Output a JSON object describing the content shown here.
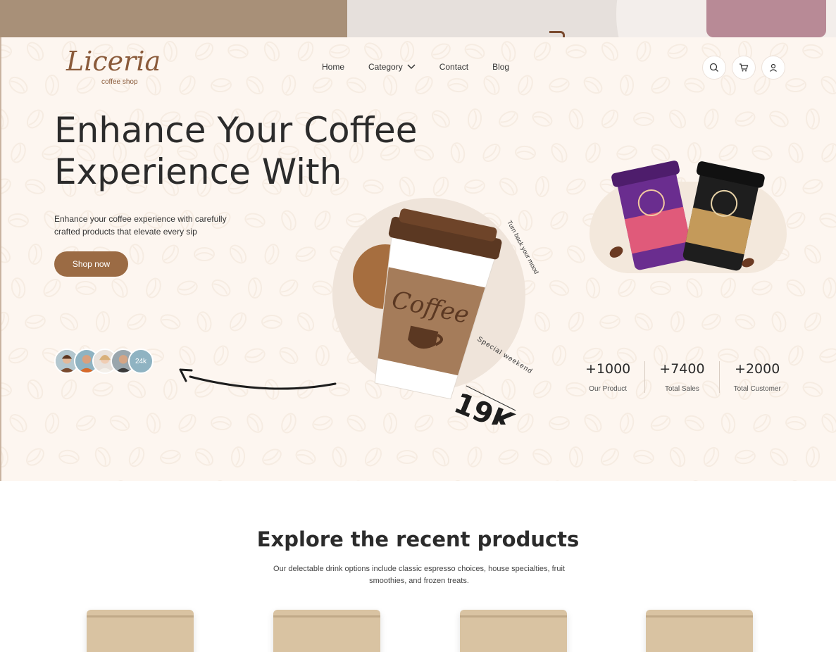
{
  "brand": {
    "logo_text": "Liceria",
    "logo_subtext": "coffee shop"
  },
  "nav": {
    "items": [
      {
        "label": "Home"
      },
      {
        "label": "Category"
      },
      {
        "label": "Contact"
      },
      {
        "label": "Blog"
      }
    ],
    "icons": [
      "search-icon",
      "cart-icon",
      "user-icon"
    ]
  },
  "hero": {
    "headline_line1": "Enhance Your Coffee",
    "headline_line2": "Experience With",
    "subtext": "Enhance your coffee experience with carefully crafted products that elevate every sip",
    "cta_label": "Shop now",
    "avatar_count_label": "24k",
    "cup_label": "Coffee",
    "curved_text": "Turn back your mood",
    "special_text": "Special weekend",
    "big_number": "19K"
  },
  "stats": [
    {
      "value": "+1000",
      "label": "Our Product"
    },
    {
      "value": "+7400",
      "label": "Total Sales"
    },
    {
      "value": "+2000",
      "label": "Total Customer"
    }
  ],
  "products": {
    "title": "Explore the recent products",
    "description": "Our delectable drink options include classic espresso choices, house specialties, fruit smoothies, and frozen treats.",
    "bag_band_colors": [
      "#e8a847",
      "#7cc47a",
      "#d9c3a2",
      "#f08a4b"
    ]
  },
  "colors": {
    "accent": "#9b6b44",
    "hero_bg": "#fdf6f0",
    "text_dark": "#2b2b2b"
  }
}
